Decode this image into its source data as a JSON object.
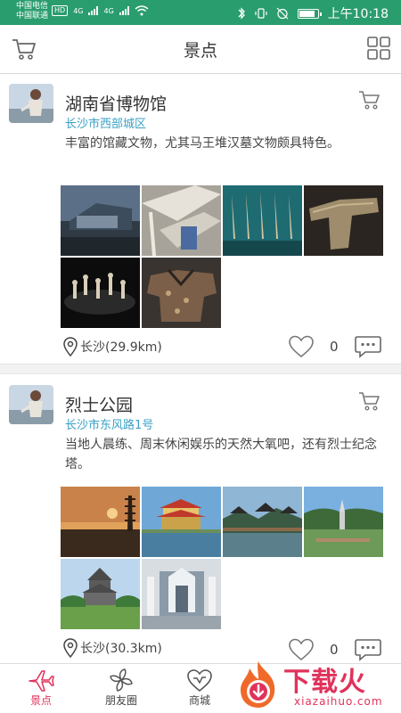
{
  "status_bar": {
    "carrier_1": "中国电信",
    "carrier_2": "中国联通",
    "hd": "HD",
    "net1": "4G",
    "net2": "4G",
    "time": "上午10:18",
    "battery_level": 0.85
  },
  "header": {
    "title": "景点"
  },
  "posts": [
    {
      "title": "湖南省博物馆",
      "address": "长沙市西部城区",
      "description": "丰富的馆藏文物，尤其马王堆汉墓文物颇具特色。",
      "location": "长沙(29.9km)",
      "likes": "0"
    },
    {
      "title": "烈士公园",
      "address": "长沙市东风路1号",
      "description": "当地人晨练、周末休闲娱乐的天然大氧吧，还有烈士纪念塔。",
      "location": "长沙(30.3km)",
      "likes": "0"
    }
  ],
  "tabs": [
    {
      "label": "景点",
      "icon": "airplane-icon",
      "active": true
    },
    {
      "label": "朋友圈",
      "icon": "pinwheel-icon",
      "active": false
    },
    {
      "label": "商城",
      "icon": "heart-shop-icon",
      "active": false
    }
  ],
  "watermark": {
    "brand": "下载火",
    "domain": "xiazaihuo.com"
  },
  "colors": {
    "status_bar": "#2a9d6e",
    "accent": "#e0325a",
    "address_link": "#3aa0c6"
  }
}
